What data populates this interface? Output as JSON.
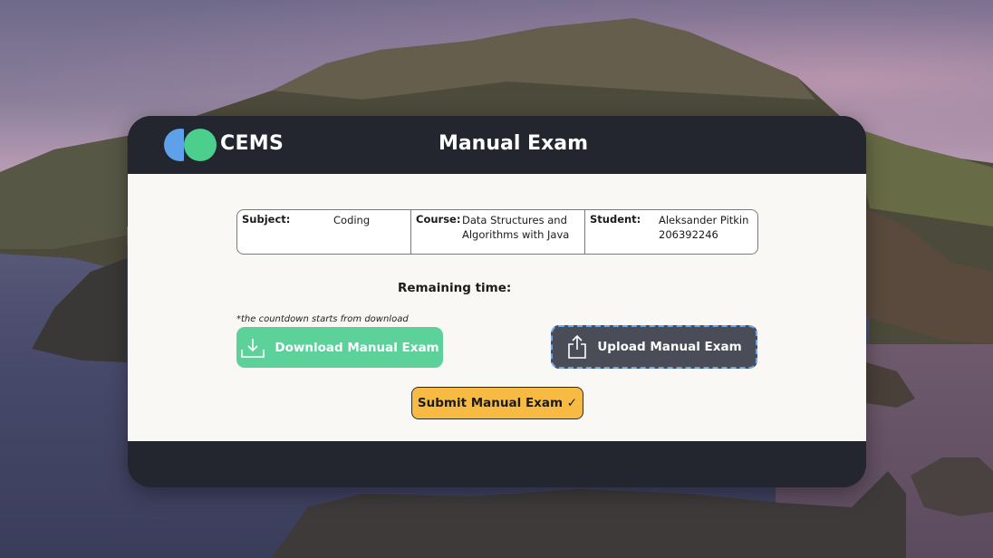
{
  "app": {
    "brand": "CEMS",
    "title": "Manual Exam"
  },
  "exam_info": {
    "subject_label": "Subject:",
    "subject_value": "Coding",
    "course_label": "Course:",
    "course_value": "Data Structures and\nAlgorithms with Java",
    "student_label": "Student:",
    "student_value": "Aleksander Pitkin\n206392246"
  },
  "timer": {
    "label": "Remaining time:",
    "note": "*the countdown starts from download"
  },
  "actions": {
    "download_label": "Download Manual Exam",
    "upload_label": "Upload Manual Exam",
    "submit_label": "Submit Manual Exam ✓"
  },
  "icons": {
    "download": "download-icon",
    "upload": "upload-icon",
    "logo": "cems-logo"
  },
  "colors": {
    "window_bg": "#23252f",
    "content_bg": "#faf8f4",
    "download_bg": "#5cd19a",
    "upload_bg": "#4a4c57",
    "submit_bg": "#f7bb43",
    "logo_blue": "#5fa0ea",
    "logo_green": "#4cce8c"
  }
}
